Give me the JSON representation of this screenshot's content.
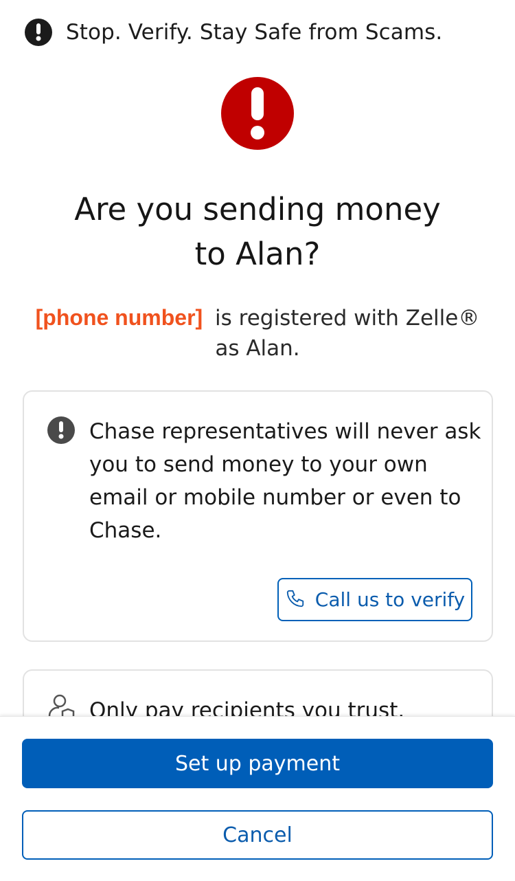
{
  "banner": {
    "text": "Stop. Verify. Stay Safe from Scams."
  },
  "title": {
    "line1": "Are you sending money",
    "line2": "to Alan?"
  },
  "subtitle": {
    "phone_placeholder": "[phone number]",
    "text": "is registered with Zelle®",
    "line2": "as Alan."
  },
  "warning_card": {
    "text": "Chase representatives will never ask you to send money to your own email or mobile number or even to Chase.",
    "verify_button_label": "Call us to verify"
  },
  "trust_card": {
    "text": "Only pay recipients you trust."
  },
  "actions": {
    "primary_label": "Set up payment",
    "secondary_label": "Cancel"
  },
  "colors": {
    "accent": "#005eb8",
    "alert": "#c00000",
    "phone": "#f0521e"
  }
}
